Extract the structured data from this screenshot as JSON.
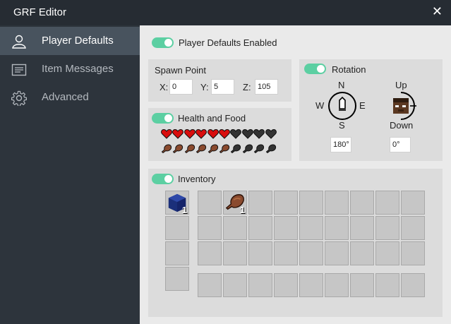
{
  "window": {
    "title": "GRF Editor",
    "close_glyph": "✕"
  },
  "sidebar": {
    "items": [
      {
        "label": "Player Defaults",
        "icon": "user-icon",
        "active": true
      },
      {
        "label": "Item Messages",
        "icon": "message-icon",
        "active": false
      },
      {
        "label": "Advanced",
        "icon": "gear-icon",
        "active": false
      }
    ]
  },
  "player_defaults": {
    "label": "Player Defaults Enabled",
    "enabled": true
  },
  "spawn": {
    "title": "Spawn Point",
    "x_label": "X:",
    "x": "0",
    "y_label": "Y:",
    "y": "5",
    "z_label": "Z:",
    "z": "105"
  },
  "health": {
    "label": "Health and Food",
    "enabled": true,
    "hearts_full": 6,
    "hearts_total": 10,
    "food_full": 6,
    "food_total": 10
  },
  "rotation": {
    "label": "Rotation",
    "enabled": true,
    "compass": {
      "n": "N",
      "s": "S",
      "w": "W",
      "e": "E"
    },
    "pitch": {
      "up": "Up",
      "down": "Down"
    },
    "yaw_value": "180°",
    "pitch_value": "0°"
  },
  "inventory": {
    "label": "Inventory",
    "enabled": true,
    "armor_slots": [
      {
        "item": "blue-block-icon",
        "count": "1"
      },
      {
        "item": "",
        "count": ""
      },
      {
        "item": "",
        "count": ""
      },
      {
        "item": "",
        "count": ""
      }
    ],
    "main_filled": [
      {
        "index": 1,
        "item": "cooked-meat-icon",
        "count": "1"
      }
    ]
  },
  "colors": {
    "accent": "#5ccfa2",
    "heart": "#d90d0d",
    "empty": "#333333",
    "meat": "#8a4a2e"
  }
}
